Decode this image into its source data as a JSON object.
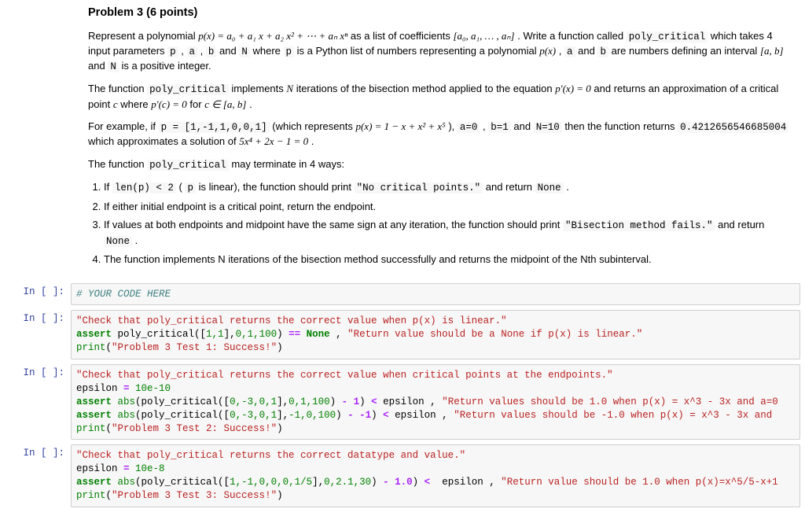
{
  "problem": {
    "heading": "Problem 3 (6 points)",
    "para1_a": "Represent a polynomial ",
    "para1_poly": "p(x) = a₀ + a₁ x + a₂ x² + ⋯ + aₙ xⁿ",
    "para1_b": " as a list of coefficients ",
    "para1_list": "[a₀, a₁, … , aₙ]",
    "para1_c": ". Write a function called ",
    "para1_funcname": "poly_critical",
    "para1_d": " which takes 4 input parameters ",
    "p_p": "p",
    "p_a": "a",
    "p_b": "b",
    "p_N": "N",
    "para1_e": " where ",
    "para1_f": " is a Python list of numbers representing a polynomial ",
    "para1_px": "p(x)",
    "para1_g": ", ",
    "para1_h": " and ",
    "para1_i": " are numbers defining an interval ",
    "para1_interval": "[a, b]",
    "para1_j": " and ",
    "para1_k": " is a positive integer.",
    "para2_a": "The function ",
    "para2_b": " implements ",
    "para2_N": "N",
    "para2_c": " iterations of the bisection method applied to the equation ",
    "para2_eq": "p′(x) = 0",
    "para2_d": " and returns an approximation of a critical point ",
    "para2_cvar": "c",
    "para2_e": " where ",
    "para2_eq2": "p′(c) = 0",
    "para2_f": " for ",
    "para2_cin": "c ∈ [a, b]",
    "para2_g": ".",
    "para3_a": "For example, if ",
    "para3_pcode": "p = [1,-1,1,0,0,1]",
    "para3_b": " (which represents ",
    "para3_poly": "p(x) = 1 − x + x² + x⁵",
    "para3_c": "), ",
    "para3_a0": "a=0",
    "para3_b1": "b=1",
    "para3_N10": "N=10",
    "para3_d": " then the function returns ",
    "para3_val": "0.4212656546685004",
    "para3_e": " which approximates a solution of ",
    "para3_deriv": "5x⁴ + 2x − 1 = 0",
    "para3_f": ".",
    "para4": "The function ",
    "para4b": " may terminate in 4 ways:",
    "li1_a": "If ",
    "li1_code1": "len(p) < 2",
    "li1_b": " (",
    "li1_p": "p",
    "li1_c": " is linear), the function should print ",
    "li1_str": "\"No critical points.\"",
    "li1_d": " and return ",
    "li1_none": "None",
    "li1_e": " .",
    "li2": "If either initial endpoint is a critical point, return the endpoint.",
    "li3_a": "If values at both endpoints and midpoint have the same sign at any iteration, the function should print ",
    "li3_str": "\"Bisection method fails.\"",
    "li3_b": " and return ",
    "li3_none": "None",
    "li3_c": " .",
    "li4": "The function implements N iterations of the bisection method successfully and returns the midpoint of the Nth subinterval."
  },
  "prompt_label": "In [ ]:",
  "cells": {
    "c1": {
      "comment": "# YOUR CODE HERE"
    },
    "c2": {
      "doc": "\"Check that poly_critical returns the correct value when p(x) is linear.\"",
      "kw_assert": "assert",
      "call": " poly_critical([",
      "nums": "1,1",
      "callmid": "],",
      "args": "0,1,100",
      "callend": ") ",
      "op": "==",
      "none": " None ",
      "comma": ", ",
      "msg": "\"Return value should be a None if p(x) is linear.\"",
      "print": "print",
      "pr_open": "(",
      "pr_str": "\"Problem 3 Test 1: Success!\"",
      "pr_close": ")"
    },
    "c3": {
      "doc": "\"Check that poly_critical returns the correct value when critical points at the endpoints.\"",
      "eps_lhs": "epsilon ",
      "op_eq": "=",
      "eps_val": " 10e-10",
      "kw_assert": "assert",
      "abs": " abs",
      "l2a": "(poly_critical([",
      "l2n": "0,-3,0,1",
      "l2b": "],",
      "l2args": "0,1,100",
      "l2c": ") ",
      "l2m": "- 1",
      "l2d": ") ",
      "l2lt": "<",
      "l2e": " epsilon , ",
      "l2msg": "\"Return values should be 1.0 when p(x) = x^3 - 3x and a=0",
      "l3a": "(poly_critical([",
      "l3n": "0,-3,0,1",
      "l3b": "],",
      "l3args": "-1,0,100",
      "l3c": ") ",
      "l3m": "- -1",
      "l3d": ") ",
      "l3lt": "<",
      "l3e": " epsilon , ",
      "l3msg": "\"Return values should be -1.0 when p(x) = x^3 - 3x and ",
      "print": "print",
      "pr_open": "(",
      "pr_str": "\"Problem 3 Test 2: Success!\"",
      "pr_close": ")"
    },
    "c4": {
      "doc": "\"Check that poly_critical returns the correct datatype and value.\"",
      "eps_lhs": "epsilon ",
      "op_eq": "=",
      "eps_val": " 10e-8",
      "kw_assert": "assert",
      "abs": " abs",
      "l2a": "(poly_critical([",
      "l2n": "1,-1,0,0,0,1/5",
      "l2b": "],",
      "l2args": "0,2.1,30",
      "l2c": ") ",
      "l2m": "- 1.0",
      "l2d": ") ",
      "l2lt": "<",
      "l2e": "  epsilon , ",
      "l2msg": "\"Return value should be 1.0 when p(x)=x^5/5-x+1",
      "print": "print",
      "pr_open": "(",
      "pr_str": "\"Problem 3 Test 3: Success!\"",
      "pr_close": ")"
    }
  }
}
